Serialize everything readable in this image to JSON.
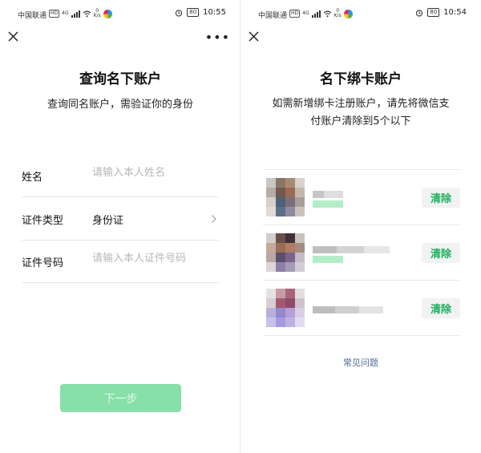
{
  "status_bar": {
    "carrier": "中国联通",
    "hd": "HD",
    "net_type": "4G",
    "speed_value": "0",
    "speed_unit": "K/s",
    "battery": "80",
    "time_left": "10:55",
    "time_right": "10:54"
  },
  "left_screen": {
    "title": "查询名下账户",
    "subtitle": "查询同名账户，需验证你的身份",
    "form": {
      "name_label": "姓名",
      "name_placeholder": "请输入本人姓名",
      "id_type_label": "证件类型",
      "id_type_value": "身份证",
      "id_number_label": "证件号码",
      "id_number_placeholder": "请输入本人证件号码"
    },
    "next_button": "下一步"
  },
  "right_screen": {
    "title": "名下绑卡账户",
    "subtitle_line1": "如需新增绑卡注册账户，请先将微信支",
    "subtitle_line2": "付账户清除到5个以下",
    "accounts": [
      {
        "clear_label": "清除"
      },
      {
        "clear_label": "清除"
      },
      {
        "clear_label": "清除"
      }
    ],
    "faq_link": "常见问题"
  },
  "colors": {
    "accent_green": "#1aad5a",
    "disabled_button": "#86e0a8",
    "link_blue": "#4b6b92"
  },
  "icons": [
    "close-icon",
    "more-icon",
    "chevron-right-icon",
    "alarm-icon",
    "wifi-icon",
    "signal-icon"
  ]
}
